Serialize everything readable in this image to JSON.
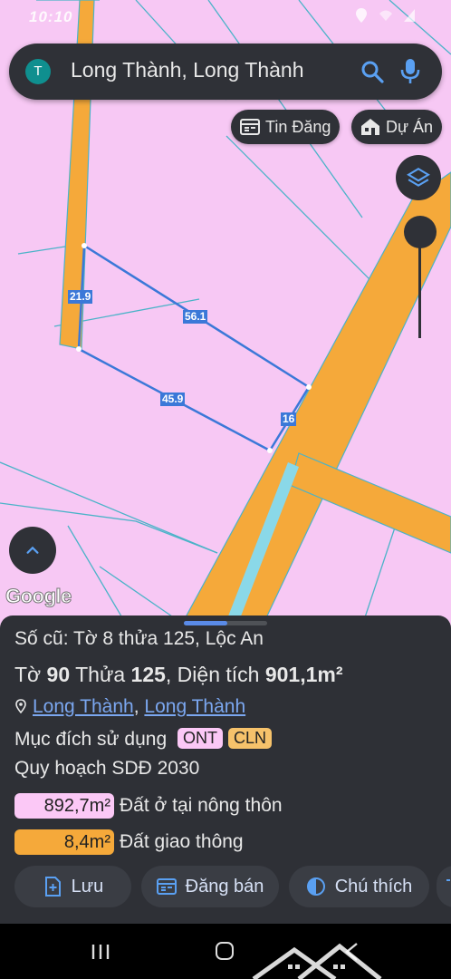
{
  "status": {
    "time": "10:10"
  },
  "search": {
    "avatar_letter": "T",
    "query": "Long Thành, Long Thành"
  },
  "chips": {
    "tin_dang": "Tin Đăng",
    "du_an": "Dự Án"
  },
  "map": {
    "google_logo": "Google",
    "edges": {
      "e1": "21.9",
      "e2": "56.1",
      "e3": "45.9",
      "e4": "16"
    },
    "colors": {
      "land": "#f7c8f4",
      "road": "#f5a93a",
      "parcel_line": "#3b78d8",
      "river": "#8ad8e8"
    }
  },
  "sheet": {
    "old_ref": "Số cũ: Tờ 8 thửa 125, Lộc An",
    "to_label": "Tờ",
    "to_value": "90",
    "thua_label": "Thửa",
    "thua_value": "125",
    "dien_tich_label": ", Diện tích",
    "dien_tich_value": "901,1m²",
    "location_a": "Long Thành",
    "location_sep": ",",
    "location_b": "Long Thành",
    "muc_dich_label": "Mục đích sử dụng",
    "tags": [
      "ONT",
      "CLN"
    ],
    "quy_hoach": "Quy hoạch SDĐ 2030",
    "areas": [
      {
        "value": "892,7m²",
        "label": "Đất ở tại nông thôn",
        "color": "#fbc8f6"
      },
      {
        "value": "8,4m²",
        "label": "Đất giao thông",
        "color": "#f5a93a"
      }
    ],
    "buttons": {
      "luu": "Lưu",
      "dang_ban": "Đăng bán",
      "chu_thich": "Chú thích"
    }
  }
}
